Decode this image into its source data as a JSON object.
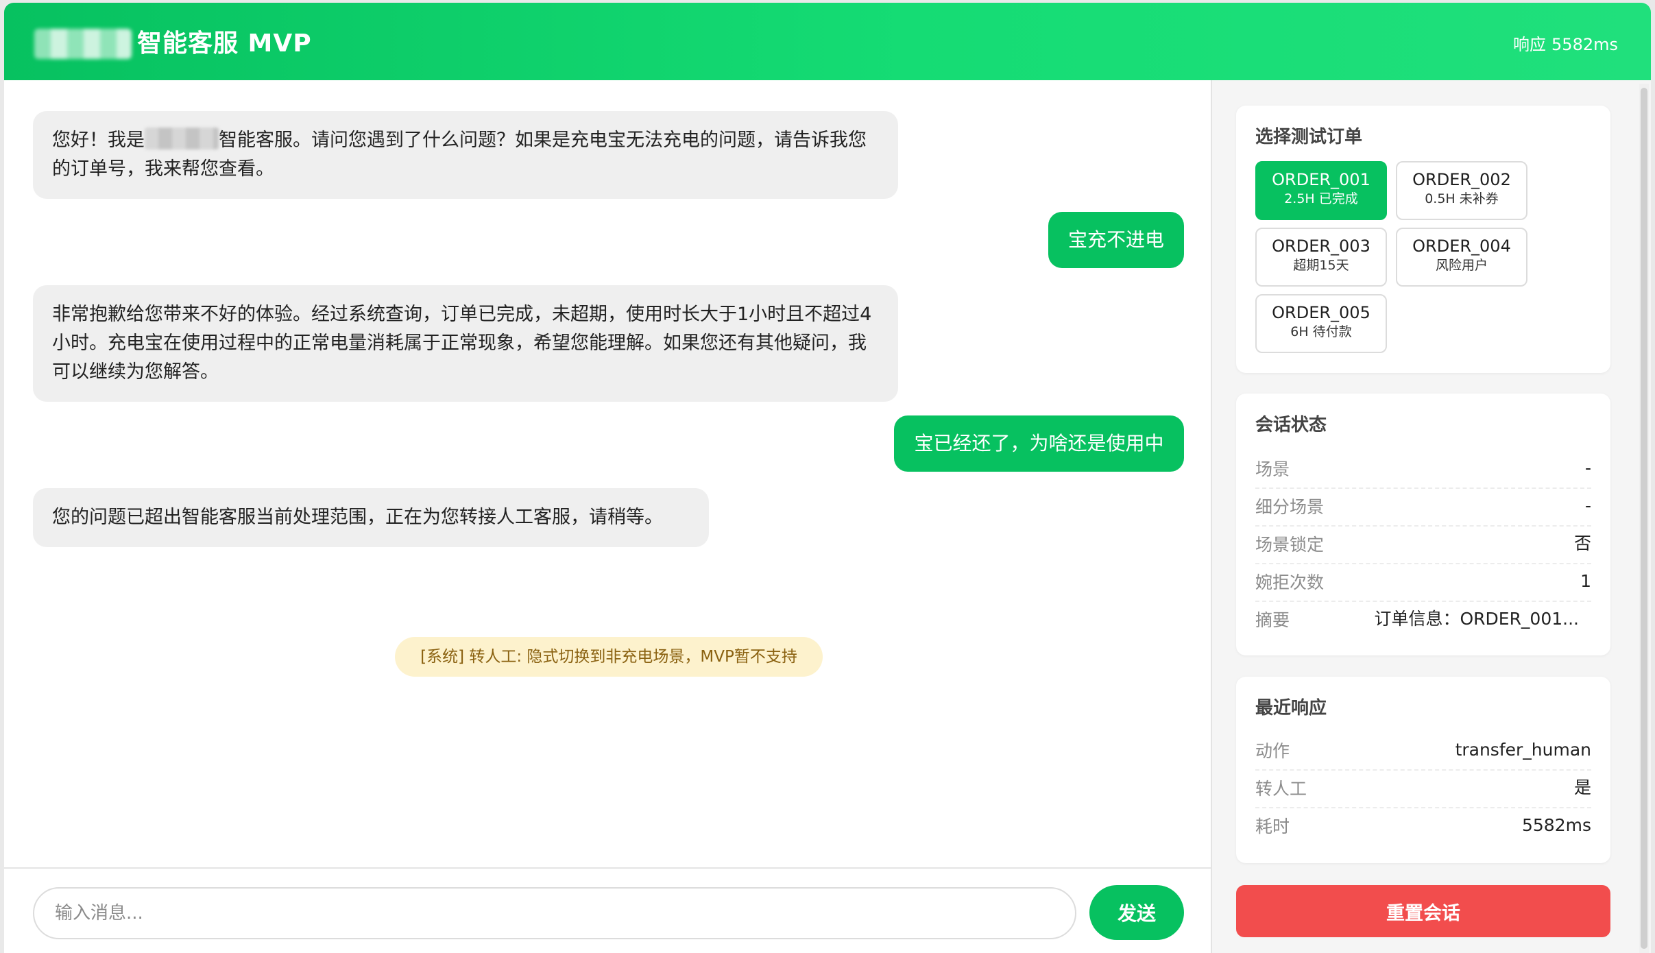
{
  "header": {
    "title": "智能客服 MVP",
    "response_label": "响应",
    "response_value": "5582ms"
  },
  "chat": {
    "messages": [
      {
        "role": "bot",
        "text_before": "您好！我是",
        "text_after": "智能客服。请问您遇到了什么问题？如果是充电宝无法充电的问题，请告诉我您的订单号，我来帮您查看。"
      },
      {
        "role": "user",
        "text": "宝充不进电"
      },
      {
        "role": "bot",
        "text": "非常抱歉给您带来不好的体验。经过系统查询，订单已完成，未超期，使用时长大于1小时且不超过4小时。充电宝在使用过程中的正常电量消耗属于正常现象，希望您能理解。如果您还有其他疑问，我可以继续为您解答。"
      },
      {
        "role": "user",
        "text": "宝已经还了，为啥还是使用中"
      },
      {
        "role": "bot",
        "text": "您的问题已超出智能客服当前处理范围，正在为您转接人工客服，请稍等。"
      }
    ],
    "system_note": "[系统] 转人工: 隐式切换到非充电场景，MVP暂不支持"
  },
  "composer": {
    "placeholder": "输入消息...",
    "send_label": "发送"
  },
  "orders_card": {
    "title": "选择测试订单",
    "orders": [
      {
        "id": "ORDER_001",
        "desc": "2.5H 已完成",
        "selected": true
      },
      {
        "id": "ORDER_002",
        "desc": "0.5H 未补券",
        "selected": false
      },
      {
        "id": "ORDER_003",
        "desc": "超期15天",
        "selected": false
      },
      {
        "id": "ORDER_004",
        "desc": "风险用户",
        "selected": false
      },
      {
        "id": "ORDER_005",
        "desc": "6H 待付款",
        "selected": false
      }
    ]
  },
  "session_card": {
    "title": "会话状态",
    "rows": [
      {
        "key": "场景",
        "value": "-"
      },
      {
        "key": "细分场景",
        "value": "-"
      },
      {
        "key": "场景锁定",
        "value": "否"
      },
      {
        "key": "婉拒次数",
        "value": "1"
      },
      {
        "key": "摘要",
        "value": "订单信息：ORDER_001..."
      }
    ]
  },
  "recent_card": {
    "title": "最近响应",
    "rows": [
      {
        "key": "动作",
        "value": "transfer_human"
      },
      {
        "key": "转人工",
        "value": "是"
      },
      {
        "key": "耗时",
        "value": "5582ms"
      }
    ]
  },
  "reset_label": "重置会话",
  "colors": {
    "brand_green": "#07c160",
    "bot_bubble": "#efefef",
    "system_note_bg": "#fdf2cd",
    "system_note_text": "#8a6110",
    "reset_red": "#f24d4d"
  }
}
